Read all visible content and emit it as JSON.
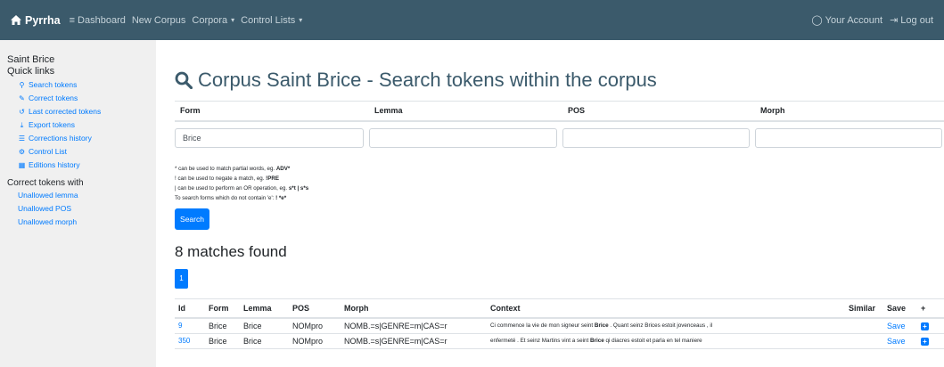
{
  "navbar": {
    "brand": "Pyrrha",
    "dashboard": "Dashboard",
    "new_corpus": "New Corpus",
    "corpora": "Corpora",
    "control_lists": "Control Lists",
    "account": "Your Account",
    "logout": "Log out"
  },
  "sidebar": {
    "corpus_name": "Saint Brice",
    "quick_links_title": "Quick links",
    "links": [
      {
        "label": "Search tokens",
        "icon": "search-icon"
      },
      {
        "label": "Correct tokens",
        "icon": "pencil-icon"
      },
      {
        "label": "Last corrected tokens",
        "icon": "history-icon"
      },
      {
        "label": "Export tokens",
        "icon": "download-icon"
      },
      {
        "label": "Corrections history",
        "icon": "list-icon"
      },
      {
        "label": "Control List",
        "icon": "cogs-icon"
      },
      {
        "label": "Editions history",
        "icon": "calendar-icon"
      }
    ],
    "correct_title": "Correct tokens with",
    "correct_links": [
      "Unallowed lemma",
      "Unallowed POS",
      "Unallowed morph"
    ]
  },
  "main": {
    "title": "Corpus Saint Brice - Search tokens within the corpus",
    "filters": {
      "headers": [
        "Form",
        "Lemma",
        "POS",
        "Morph"
      ],
      "values": [
        "Brice",
        "",
        "",
        ""
      ]
    },
    "help": [
      {
        "text": "* can be used to match partial words, eg. ",
        "bold": "ADV*"
      },
      {
        "text": "! can be used to negate a match, eg. ",
        "bold": "!PRE"
      },
      {
        "text": "| can be used to perform an OR operation, eg. ",
        "bold": "s*t | s*s"
      },
      {
        "text": "To search forms which do not contain 'e': ",
        "bold": "! *e*"
      }
    ],
    "search_button": "Search",
    "matches": "8 matches found",
    "page": "1",
    "results": {
      "headers": [
        "Id",
        "Form",
        "Lemma",
        "POS",
        "Morph",
        "Context",
        "Similar",
        "Save",
        "+"
      ],
      "rows": [
        {
          "id": "9",
          "form": "Brice",
          "lemma": "Brice",
          "pos": "NOMpro",
          "morph": "NOMB.=s|GENRE=m|CAS=r",
          "ctx_before": "Ci commence la vie de mon signeur seint ",
          "ctx_token": "Brice",
          "ctx_after": " . Quant seinz Brices estoit jovenceaus , il",
          "similar": "",
          "save": "Save"
        },
        {
          "id": "350",
          "form": "Brice",
          "lemma": "Brice",
          "pos": "NOMpro",
          "morph": "NOMB.=s|GENRE=m|CAS=r",
          "ctx_before": "enfermeté . Et seinz Martins vint a seint ",
          "ctx_token": "Brice",
          "ctx_after": " qi diacres estoit et parla en tel maniere",
          "similar": "",
          "save": "Save"
        }
      ]
    }
  }
}
